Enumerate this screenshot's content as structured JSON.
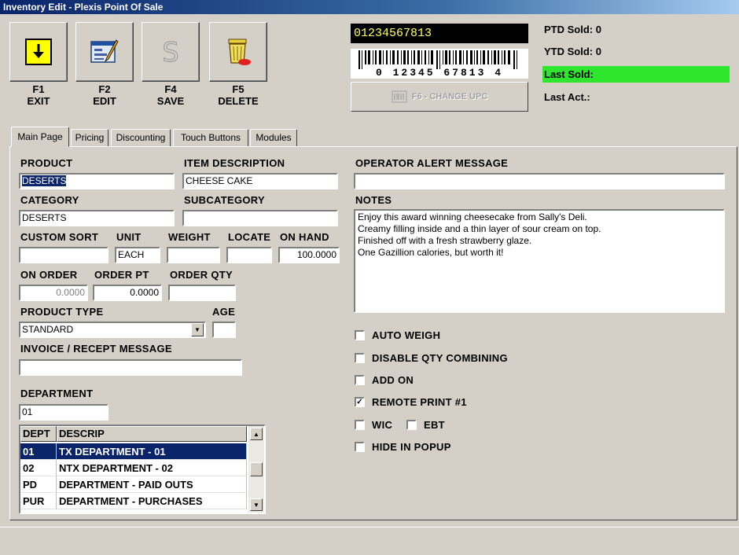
{
  "window": {
    "title": "Inventory Edit - Plexis Point Of Sale"
  },
  "toolbar": {
    "exit": {
      "key": "F1",
      "label": "EXIT"
    },
    "edit": {
      "key": "F2",
      "label": "EDIT"
    },
    "save": {
      "key": "F4",
      "label": "SAVE"
    },
    "delete": {
      "key": "F5",
      "label": "DELETE"
    }
  },
  "upc": {
    "value": "01234567813",
    "barcode_text": "0 12345 67813 4",
    "change_button": "F6 - CHANGE UPC"
  },
  "stats": {
    "ptd_sold": "PTD Sold: 0",
    "ytd_sold": "YTD Sold: 0",
    "last_sold": "Last Sold:",
    "last_act": "Last Act.:"
  },
  "tabs": [
    "Main Page",
    "Pricing",
    "Discounting",
    "Touch Buttons",
    "Modules"
  ],
  "form": {
    "product": {
      "label": "PRODUCT",
      "value": "DESERTS"
    },
    "item_description": {
      "label": "ITEM DESCRIPTION",
      "value": "CHEESE CAKE"
    },
    "category": {
      "label": "CATEGORY",
      "value": "DESERTS"
    },
    "subcategory": {
      "label": "SUBCATEGORY",
      "value": ""
    },
    "custom_sort": {
      "label": "CUSTOM SORT",
      "value": ""
    },
    "unit": {
      "label": "UNIT",
      "value": "EACH"
    },
    "weight": {
      "label": "WEIGHT",
      "value": ""
    },
    "locate": {
      "label": "LOCATE",
      "value": ""
    },
    "on_hand": {
      "label": "ON HAND",
      "value": "100.0000"
    },
    "on_order": {
      "label": "ON ORDER",
      "value": "0.0000"
    },
    "order_pt": {
      "label": "ORDER PT",
      "value": "0.0000"
    },
    "order_qty": {
      "label": "ORDER QTY",
      "value": ""
    },
    "product_type": {
      "label": "PRODUCT TYPE",
      "value": "STANDARD"
    },
    "age": {
      "label": "AGE",
      "value": ""
    },
    "invoice_message": {
      "label": "INVOICE / RECEPT MESSAGE",
      "value": ""
    },
    "department": {
      "label": "DEPARTMENT",
      "value": "01"
    },
    "operator_alert": {
      "label": "OPERATOR ALERT MESSAGE",
      "value": ""
    },
    "notes": {
      "label": "NOTES",
      "lines": [
        "Enjoy this award winning cheesecake from Sally's Deli.",
        "Creamy filling inside and a thin layer of sour cream on top.",
        "Finished off with a fresh strawberry glaze.",
        "One Gazillion calories, but worth it!"
      ]
    }
  },
  "department_grid": {
    "headers": [
      "DEPT",
      "DESCRIP"
    ],
    "rows": [
      {
        "dept": "01",
        "descrip": "TX DEPARTMENT - 01",
        "selected": true
      },
      {
        "dept": "02",
        "descrip": "NTX DEPARTMENT - 02",
        "selected": false
      },
      {
        "dept": "PD",
        "descrip": "DEPARTMENT - PAID OUTS",
        "selected": false
      },
      {
        "dept": "PUR",
        "descrip": "DEPARTMENT - PURCHASES",
        "selected": false
      }
    ]
  },
  "options": {
    "auto_weigh": {
      "label": "AUTO WEIGH",
      "checked": false
    },
    "disable_qty_combining": {
      "label": "DISABLE QTY COMBINING",
      "checked": false
    },
    "add_on": {
      "label": "ADD ON",
      "checked": false
    },
    "remote_print": {
      "label": "REMOTE PRINT #1",
      "checked": true
    },
    "wic": {
      "label": "WIC",
      "checked": false
    },
    "ebt": {
      "label": "EBT",
      "checked": false
    },
    "hide_in_popup": {
      "label": "HIDE IN POPUP",
      "checked": false
    }
  },
  "colors": {
    "title_bar": "#0a246a",
    "selection": "#0a246a",
    "last_sold_bg": "#2ee62e",
    "upc_text": "#ffff60"
  }
}
